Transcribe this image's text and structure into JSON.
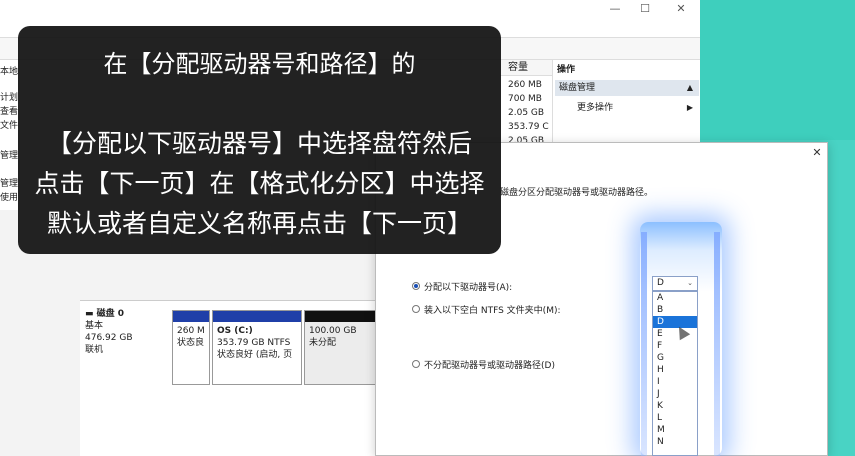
{
  "window": {
    "controls": [
      "—",
      "☐",
      "✕"
    ]
  },
  "tree": {
    "items": [
      "本地",
      "计划",
      "查看",
      "文件",
      "管理",
      "管理",
      "使用"
    ]
  },
  "volume_list": {
    "column_header": "容量",
    "rows": [
      "260 MB",
      "700 MB",
      "2.05 GB",
      "353.79 C",
      "2.05 GB"
    ]
  },
  "actions": {
    "header": "操作",
    "primary": "磁盘管理",
    "more": "更多操作"
  },
  "disk": {
    "name": "磁盘 0",
    "type": "基本",
    "size": "476.92 GB",
    "status": "联机",
    "partitions": [
      {
        "line1": "260 M",
        "line2": "状态良",
        "bar_color": "#1f3fa8"
      },
      {
        "line1": "OS (C:)",
        "line2": "353.79 GB NTFS",
        "line3": "状态良好 (启动, 页",
        "bar_color": "#1f3fa8"
      },
      {
        "line1": "100.00 GB",
        "line2": "未分配",
        "bar_color": "#111111"
      }
    ]
  },
  "dialog": {
    "close": "✕",
    "description": "磁盘分区分配驱动器号或驱动器路径。",
    "option_assign": "分配以下驱动器号(A):",
    "option_mount": "装入以下空白 NTFS 文件夹中(M):",
    "option_none": "不分配驱动器号或驱动器路径(D)",
    "drive_selected": "D",
    "drive_options": [
      "A",
      "B",
      "D",
      "E",
      "F",
      "G",
      "H",
      "I",
      "J",
      "K",
      "L",
      "M",
      "N"
    ]
  },
  "overlay": {
    "line1": "在【分配驱动器号和路径】的",
    "line2": "【分配以下驱动器号】中选择盘符然后",
    "line3": "点击【下一页】在【格式化分区】中选择",
    "line4": "默认或者自定义名称再点击【下一页】"
  },
  "colors": {
    "background": "#49d3c4",
    "selection": "#1a73d9",
    "partition_primary": "#1f3fa8",
    "unallocated": "#111111"
  }
}
